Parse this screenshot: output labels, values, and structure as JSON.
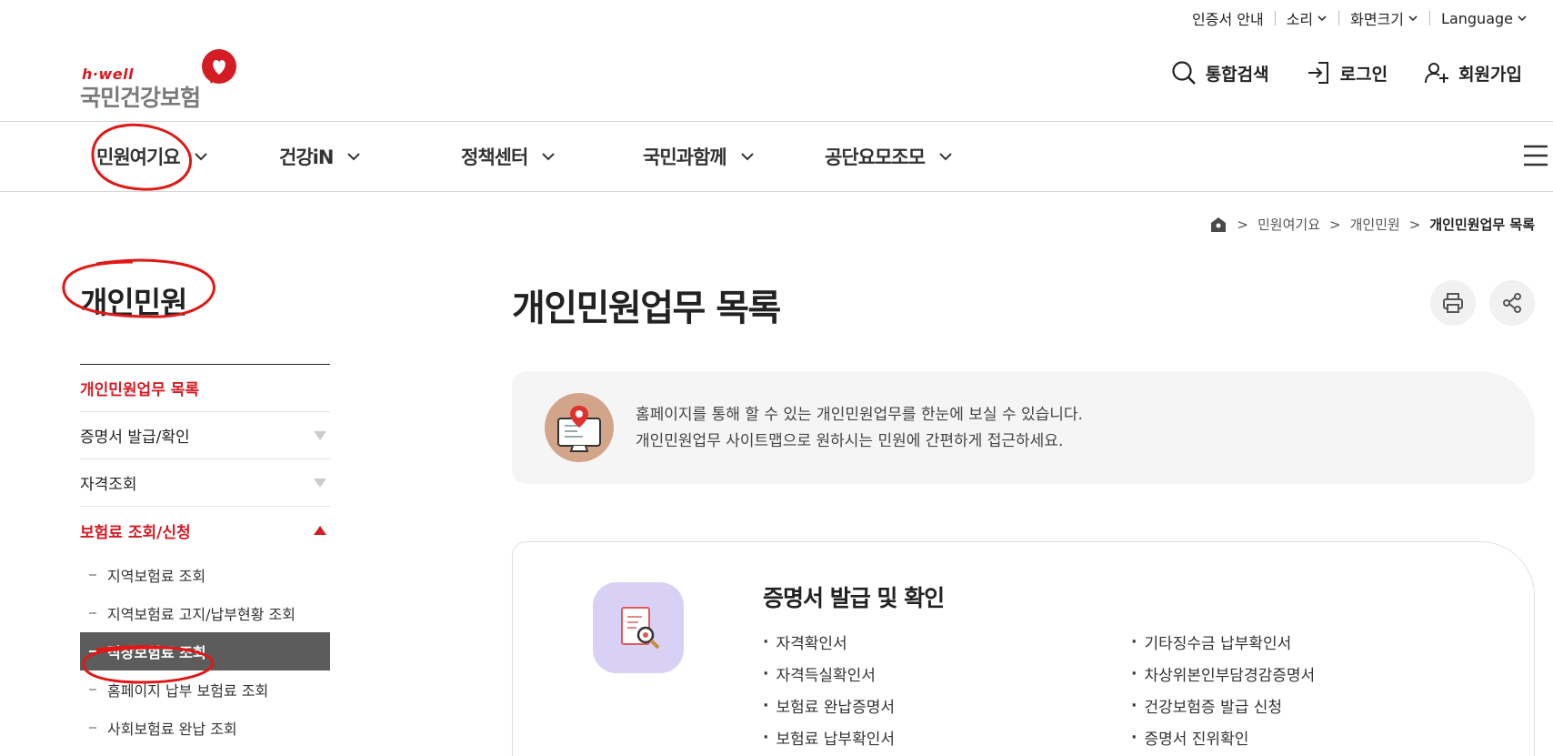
{
  "utility": {
    "certificate": "인증서 안내",
    "sound": "소리",
    "font_size": "화면크기",
    "language": "Language"
  },
  "logo": {
    "sub": "h·well",
    "main": "국민건강보험"
  },
  "header": {
    "search": "통합검색",
    "login": "로그인",
    "signup": "회원가입"
  },
  "gnb": {
    "items": [
      "민원여기요",
      "건강iN",
      "정책센터",
      "국민과함께",
      "공단요모조모"
    ]
  },
  "breadcrumb": {
    "items": [
      "민원여기요",
      "개인민원",
      "개인민원업무 목록"
    ]
  },
  "sidebar": {
    "title": "개인민원",
    "items": [
      {
        "label": "개인민원업무 목록"
      },
      {
        "label": "증명서 발급/확인"
      },
      {
        "label": "자격조회"
      },
      {
        "label": "보험료 조회/신청"
      }
    ],
    "sub_items": [
      "지역보험료 조회",
      "지역보험료 고지/납부현황 조회",
      "직장보험료 조회",
      "홈페이지 납부 보험료 조회",
      "사회보험료 완납 조회"
    ]
  },
  "main": {
    "title": "개인민원업무 목록",
    "info_line1": "홈페이지를 통해 할 수 있는 개인민원업무를 한눈에 보실 수 있습니다.",
    "info_line2": "개인민원업무 사이트맵으로 원하시는 민원에 간편하게 접근하세요.",
    "card": {
      "title": "증명서 발급 및 확인",
      "left": [
        "자격확인서",
        "자격득실확인서",
        "보험료 완납증명서",
        "보험료 납부확인서"
      ],
      "right": [
        "기타징수금 납부확인서",
        "차상위본인부담경감증명서",
        "건강보험증 발급 신청",
        "증명서 진위확인"
      ]
    }
  },
  "colors": {
    "brand_red": "#d41c24",
    "selected_bg": "#5c5c5c"
  }
}
